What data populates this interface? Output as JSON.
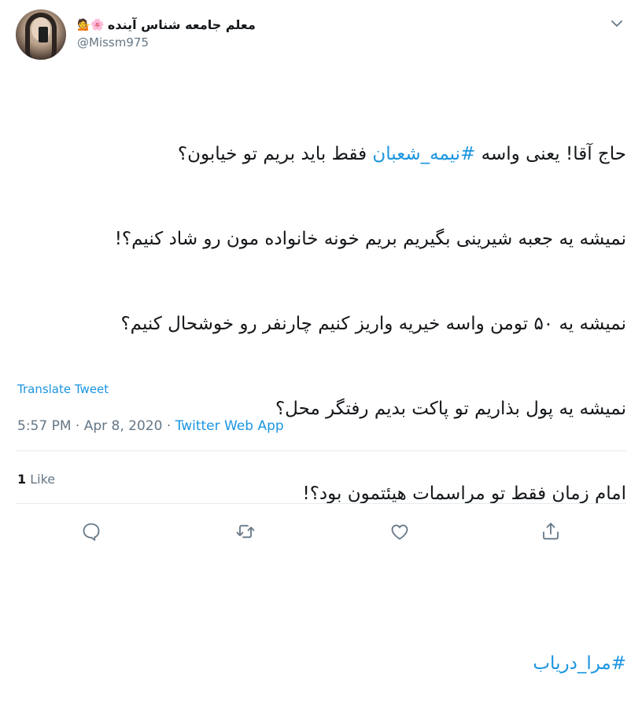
{
  "user": {
    "display_name": "معلم جامعه شناس آینده",
    "name_emojis": "💁🌸",
    "handle": "@Missm975"
  },
  "tweet": {
    "line1_pre": "حاج آقا! یعنی واسه ",
    "hashtag1": "#نیمه_شعبان",
    "line1_post": " فقط باید بریم تو خیابون؟",
    "line2": "نمیشه یه جعبه شیرینی بگیریم بریم خونه خانواده مون رو شاد کنیم؟!",
    "line3": "نمیشه یه ۵۰ تومن واسه خیریه واریز کنیم چارنفر رو خوشحال کنیم؟",
    "line4": "نمیشه یه پول بذاریم تو پاکت بدیم رفتگر محل؟",
    "line5": "امام زمان فقط تو مراسمات هیئتمون بود؟!",
    "hashtag2": "#مرا_دریاب"
  },
  "translate_label": "Translate Tweet",
  "meta": {
    "time": "5:57 PM",
    "sep1": " · ",
    "date": "Apr 8, 2020",
    "sep2": " · ",
    "app": "Twitter Web App"
  },
  "stats": {
    "like_count": "1",
    "like_label": "Like"
  },
  "actions": [
    "reply-icon",
    "retweet-icon",
    "like-icon",
    "share-icon"
  ],
  "colors": {
    "link": "#1b95e0",
    "secondary": "#657786",
    "text": "#14171a",
    "divider": "#e6ecf0"
  }
}
